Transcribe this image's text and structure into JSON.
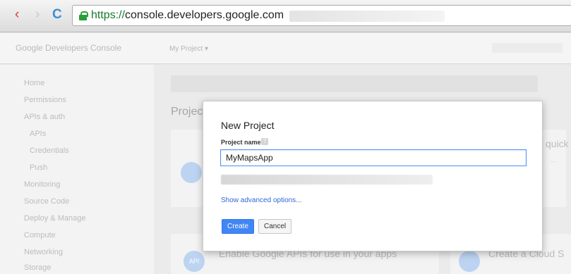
{
  "browser": {
    "back_icon": "‹",
    "forward_icon": "›",
    "reload_icon": "C",
    "url_scheme": "https://",
    "url_host": "console.developers.google.com"
  },
  "console": {
    "logo_text": "Google Developers Console",
    "project_switcher": "My Project ▾"
  },
  "sidebar": {
    "items": [
      {
        "label": "Home"
      },
      {
        "label": "Permissions"
      },
      {
        "label": "APIs & auth"
      },
      {
        "label": "APIs"
      },
      {
        "label": "Credentials"
      },
      {
        "label": "Push"
      },
      {
        "label": "Monitoring"
      },
      {
        "label": "Source Code"
      },
      {
        "label": "Deploy & Manage"
      },
      {
        "label": "Compute"
      },
      {
        "label": "Networking"
      },
      {
        "label": "Storage"
      }
    ]
  },
  "main": {
    "section_title": "Projects",
    "enable_apis_text": "Enable Google APIs for use in your apps",
    "create_cloud_text": "Create a Cloud S",
    "right_card_text": "quick",
    "api_badge": "API"
  },
  "dialog": {
    "title": "New Project",
    "field_label": "Project name",
    "help_icon": "?",
    "project_name_value": "MyMapsApp",
    "advanced_link": "Show advanced options...",
    "create_label": "Create",
    "cancel_label": "Cancel"
  },
  "colors": {
    "primary_blue": "#4285f4",
    "link_blue": "#3367d6",
    "secure_green": "#1a7a2a"
  }
}
